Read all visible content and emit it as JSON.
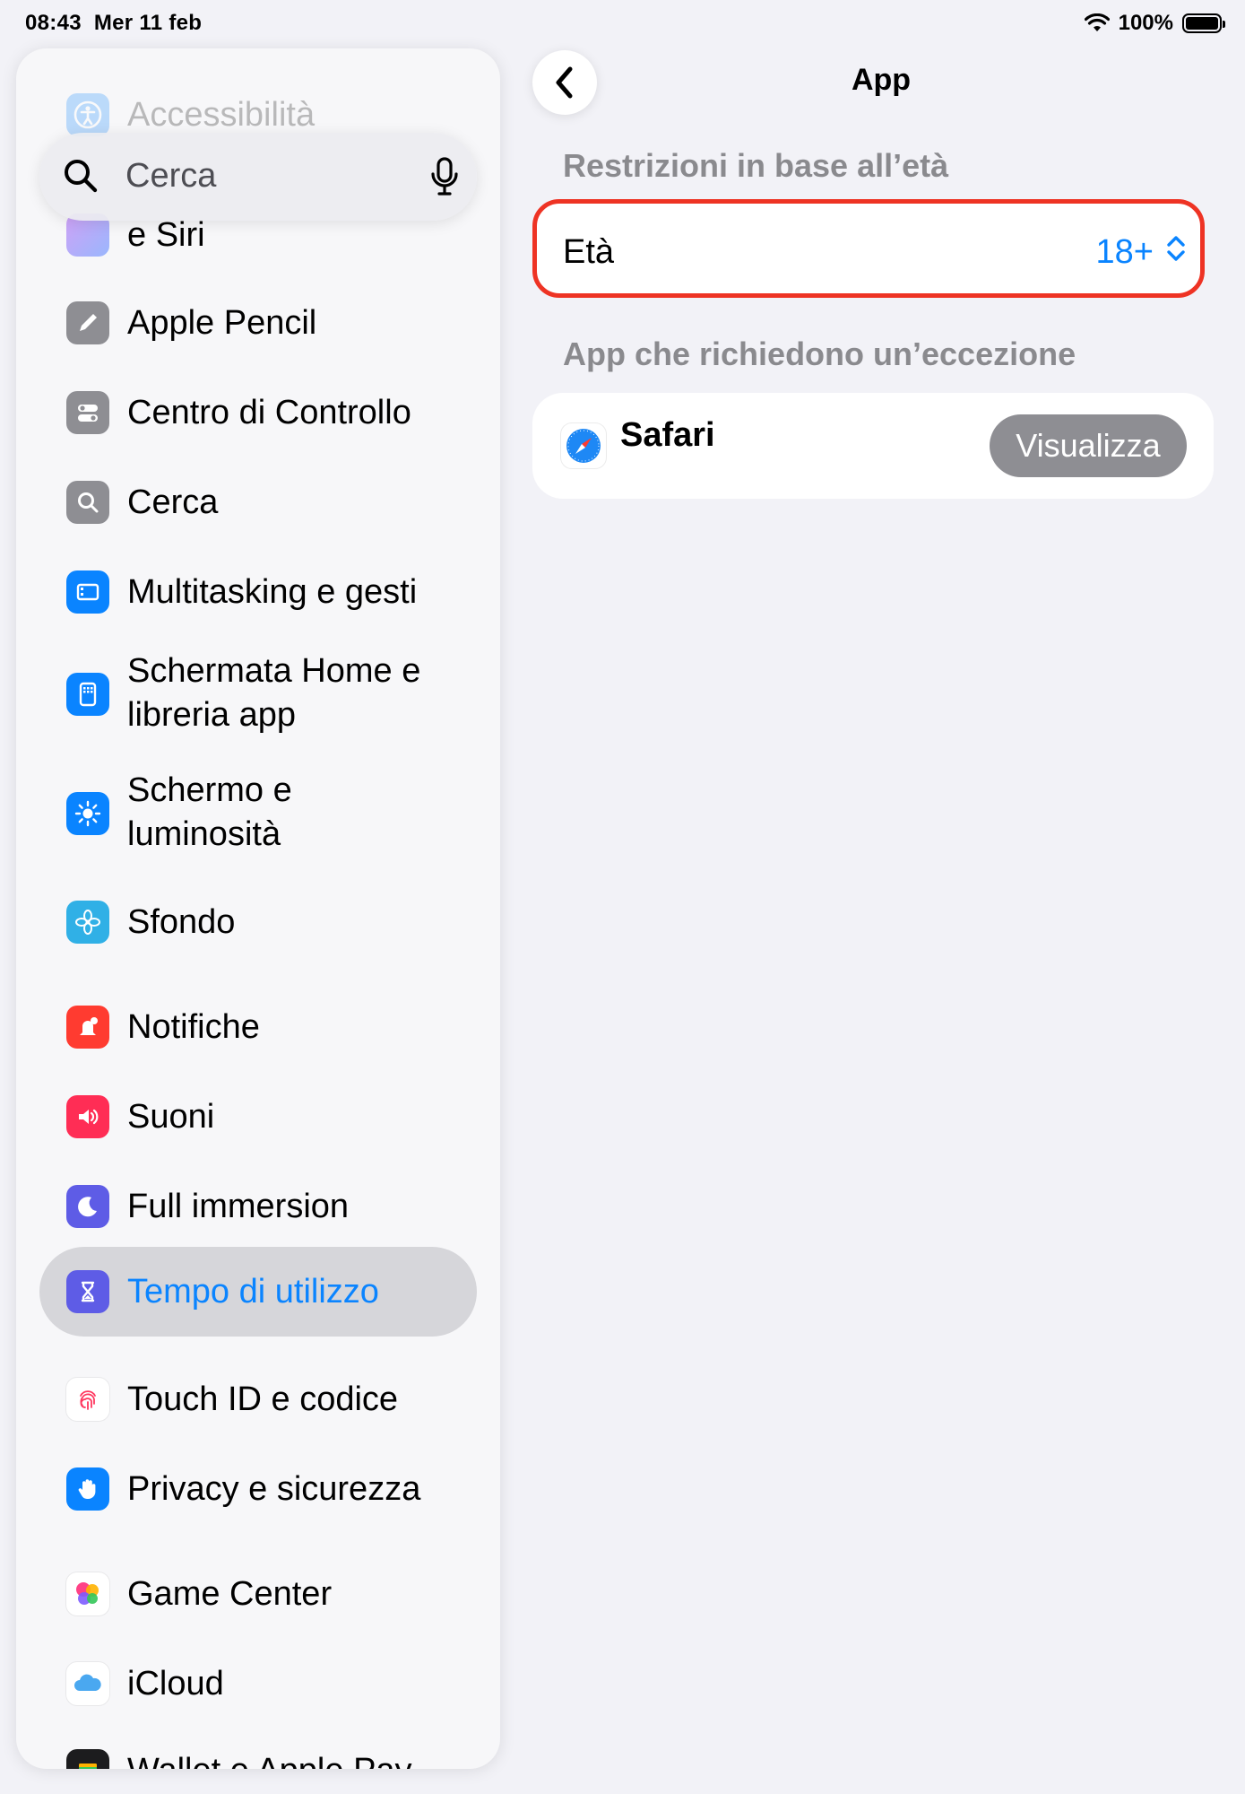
{
  "status_bar": {
    "time": "08:43",
    "date": "Mer 11 feb",
    "battery": "100%",
    "wifi_icon": "wifi-icon",
    "battery_icon": "battery-icon"
  },
  "sidebar": {
    "search": {
      "placeholder": "Cerca",
      "search_icon": "magnifier-icon",
      "mic_icon": "microphone-icon"
    },
    "items": [
      {
        "label": "Accessibilità",
        "icon": "accessibility-icon",
        "color": "#0a84ff"
      },
      {
        "label": "e Siri",
        "icon": "siri-icon",
        "color": "#8e5cf7"
      },
      {
        "label": "Apple Pencil",
        "icon": "pencil-icon",
        "color": "#8e8e93"
      },
      {
        "label": "Centro di Controllo",
        "icon": "toggles-icon",
        "color": "#8e8e93"
      },
      {
        "label": "Cerca",
        "icon": "search-icon",
        "color": "#8e8e93"
      },
      {
        "label": "Multitasking e gesti",
        "icon": "multitasking-icon",
        "color": "#0a84ff"
      },
      {
        "label": "Schermata Home e libreria app",
        "icon": "home-screen-icon",
        "color": "#0a84ff"
      },
      {
        "label": "Schermo e luminosità",
        "icon": "brightness-icon",
        "color": "#0a84ff"
      },
      {
        "label": "Sfondo",
        "icon": "flower-icon",
        "color": "#30b0e6"
      },
      {
        "label": "Notifiche",
        "icon": "notification-bell-icon",
        "color": "#ff3b30"
      },
      {
        "label": "Suoni",
        "icon": "speaker-icon",
        "color": "#ff2d55"
      },
      {
        "label": "Full immersion",
        "icon": "moon-icon",
        "color": "#5e5ce6"
      },
      {
        "label": "Tempo di utilizzo",
        "icon": "hourglass-icon",
        "color": "#5e5ce6",
        "selected": true
      },
      {
        "label": "Touch ID e codice",
        "icon": "fingerprint-icon",
        "color": "#ff375f"
      },
      {
        "label": "Privacy e sicurezza",
        "icon": "hand-icon",
        "color": "#0a84ff"
      },
      {
        "label": "Game Center",
        "icon": "game-center-icon",
        "color": "#ff9f0a"
      },
      {
        "label": "iCloud",
        "icon": "cloud-icon",
        "color": "#4aa8f0"
      },
      {
        "label": "Wallet e Apple Pay",
        "icon": "wallet-icon",
        "color": "#1c1c1e"
      }
    ]
  },
  "detail": {
    "title": "App",
    "back_icon": "chevron-left-icon",
    "age_section_header": "Restrizioni in base all’età",
    "age_row": {
      "label": "Età",
      "value": "18+",
      "icon": "chevron-up-down-icon"
    },
    "exception_section_header": "App che richiedono un’eccezione",
    "exception_app": {
      "name": "Safari",
      "icon": "safari-compass-icon",
      "button": "Visualizza"
    },
    "colors": {
      "accent": "#0a84ff",
      "highlight_border": "#ee3324",
      "button_gray": "#8e8e93"
    }
  }
}
